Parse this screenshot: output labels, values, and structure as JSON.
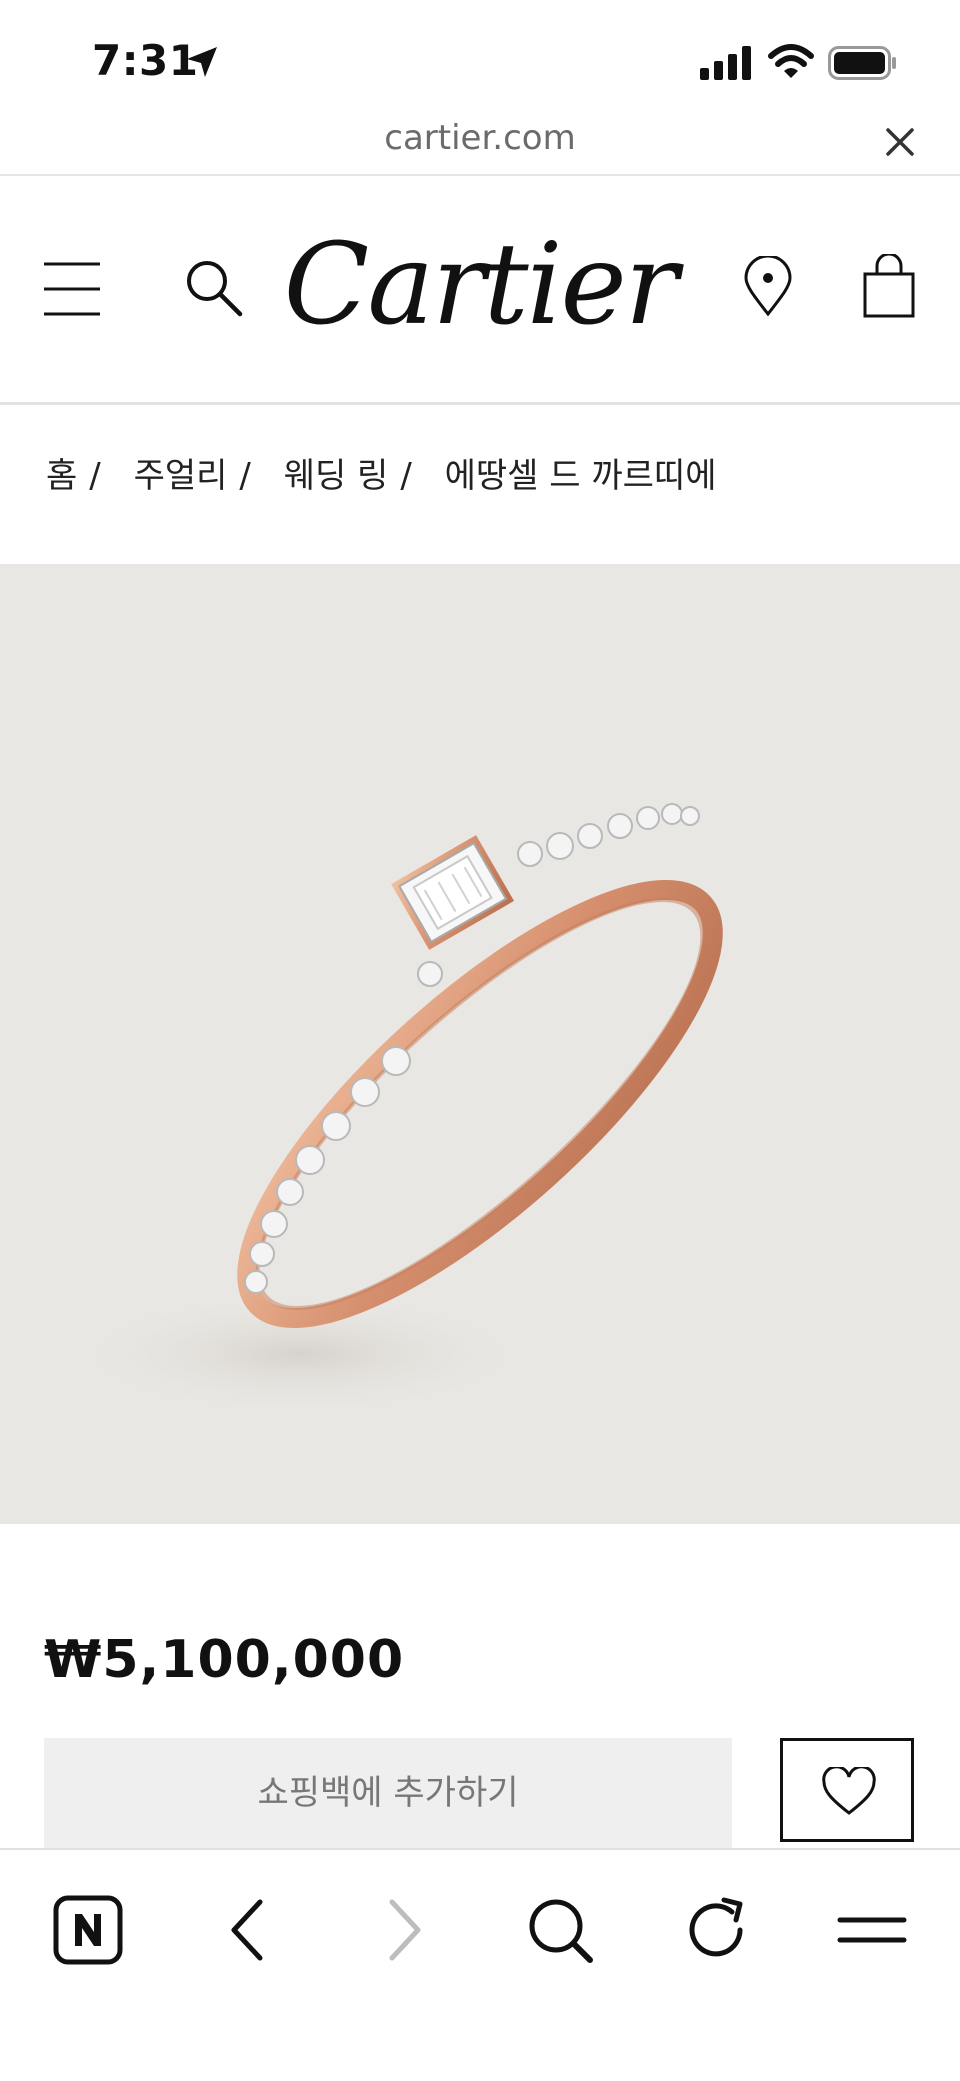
{
  "status_bar": {
    "time": "7:31",
    "icons": [
      "location-arrow-icon",
      "cellular-signal-icon",
      "wifi-icon",
      "battery-icon"
    ]
  },
  "url_bar": {
    "url": "cartier.com",
    "close_icon": "close-icon"
  },
  "header": {
    "logo": "Cartier",
    "icons": [
      "menu-icon",
      "search-icon",
      "store-locator-icon",
      "shopping-bag-icon"
    ]
  },
  "breadcrumb": {
    "items": [
      "홈",
      "주얼리",
      "웨딩 링",
      "에땅셀 드 까르띠에"
    ],
    "separator": "/"
  },
  "product": {
    "image_alt": "rose gold ring with emerald-cut diamond",
    "next_icon": "chevron-right-icon",
    "price": "₩5,100,000",
    "add_to_bag_label": "쇼핑백에 추가하기",
    "wishlist_icon": "heart-icon"
  },
  "browser_toolbar": {
    "icons": [
      "naver-icon",
      "back-icon",
      "forward-icon",
      "search-icon",
      "reload-icon",
      "menu-icon"
    ]
  },
  "colors": {
    "image_background": "#e9e7e3",
    "rose_gold": "#d58f6e",
    "button_gray": "#efefef"
  }
}
